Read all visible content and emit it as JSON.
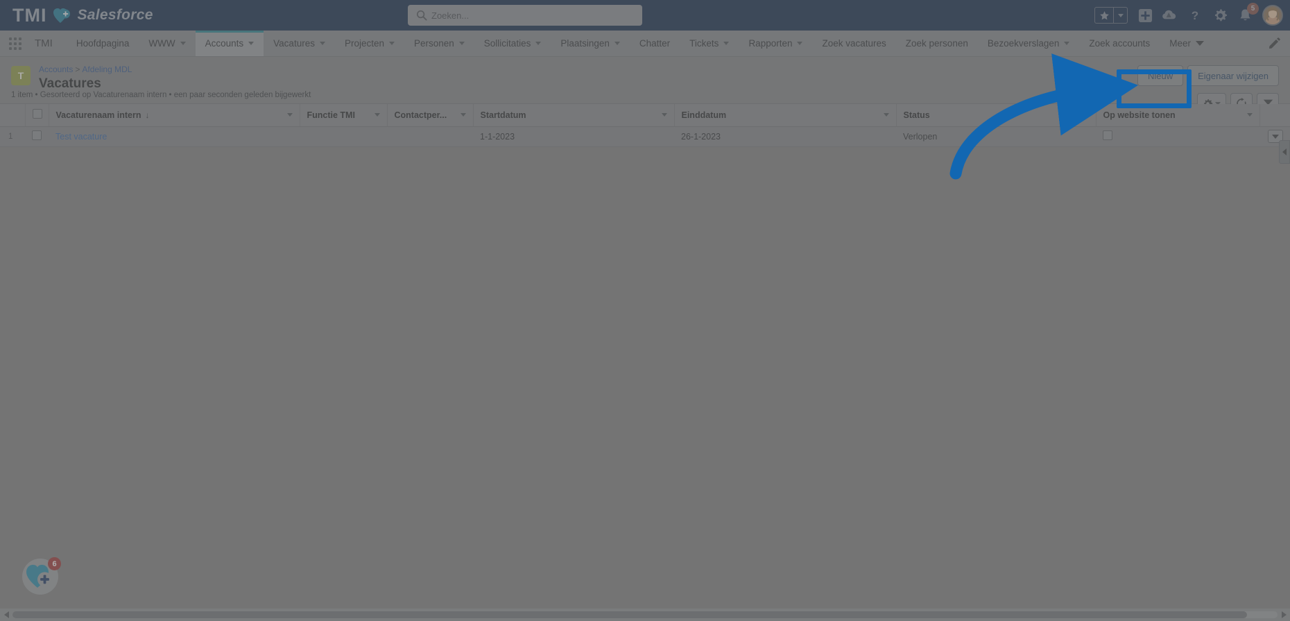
{
  "header": {
    "logo_primary": "TMI",
    "logo_secondary": "Salesforce",
    "search_placeholder": "Zoeken...",
    "search_value": "",
    "notification_count": "5",
    "icons": [
      "favorites-star-icon",
      "favorites-caret-icon",
      "add-icon",
      "cloud-icon",
      "help-icon",
      "setup-gear-icon",
      "notifications-bell-icon",
      "user-avatar"
    ]
  },
  "nav": {
    "app_name": "TMI",
    "items": [
      {
        "label": "Hoofdpagina",
        "has_menu": false,
        "active": false
      },
      {
        "label": "WWW",
        "has_menu": true,
        "active": false
      },
      {
        "label": "Accounts",
        "has_menu": true,
        "active": true
      },
      {
        "label": "Vacatures",
        "has_menu": true,
        "active": false
      },
      {
        "label": "Projecten",
        "has_menu": true,
        "active": false
      },
      {
        "label": "Personen",
        "has_menu": true,
        "active": false
      },
      {
        "label": "Sollicitaties",
        "has_menu": true,
        "active": false
      },
      {
        "label": "Plaatsingen",
        "has_menu": true,
        "active": false
      },
      {
        "label": "Chatter",
        "has_menu": false,
        "active": false
      },
      {
        "label": "Tickets",
        "has_menu": true,
        "active": false
      },
      {
        "label": "Rapporten",
        "has_menu": true,
        "active": false
      },
      {
        "label": "Zoek vacatures",
        "has_menu": false,
        "active": false
      },
      {
        "label": "Zoek personen",
        "has_menu": false,
        "active": false
      },
      {
        "label": "Bezoekverslagen",
        "has_menu": true,
        "active": false
      },
      {
        "label": "Zoek accounts",
        "has_menu": false,
        "active": false
      }
    ],
    "more_label": "Meer"
  },
  "page": {
    "object_icon_letter": "T",
    "breadcrumb": {
      "parent": "Accounts",
      "separator": ">",
      "current": "Afdeling MDL"
    },
    "title": "Vacatures",
    "meta": "1 item • Gesorteerd op Vacaturenaam intern • een paar seconden geleden bijgewerkt",
    "actions": {
      "new_label": "Nieuw",
      "change_owner_label": "Eigenaar wijzigen"
    },
    "tools": [
      "list-view-controls-gear-icon",
      "refresh-icon",
      "filter-icon"
    ]
  },
  "table": {
    "columns": [
      {
        "label": "Vacaturenaam intern",
        "sorted": true,
        "sort_arrow": "↓",
        "has_menu": true
      },
      {
        "label": "Functie TMI",
        "sorted": false,
        "has_menu": true
      },
      {
        "label": "Contactper...",
        "sorted": false,
        "has_menu": true
      },
      {
        "label": "Startdatum",
        "sorted": false,
        "has_menu": true
      },
      {
        "label": "Einddatum",
        "sorted": false,
        "has_menu": true
      },
      {
        "label": "Status",
        "sorted": false,
        "has_menu": true
      },
      {
        "label": "Op website tonen",
        "sorted": false,
        "has_menu": true
      }
    ],
    "rows": [
      {
        "index": "1",
        "selected": false,
        "name": "Test vacature",
        "functie": "",
        "contactpersoon": "",
        "startdatum": "1-1-2023",
        "einddatum": "26-1-2023",
        "status": "Verlopen",
        "op_website_tonen": false
      }
    ]
  },
  "floating_widget": {
    "badge": "6",
    "icon": "heart-plus-icon"
  },
  "colors": {
    "brand_dark": "#041e42",
    "accent_teal": "#1a7f8e",
    "link_blue": "#2a5fa5",
    "annotation_blue": "#1267b2",
    "object_icon": "#8e9a3c",
    "badge_red": "#9d2b2b"
  }
}
